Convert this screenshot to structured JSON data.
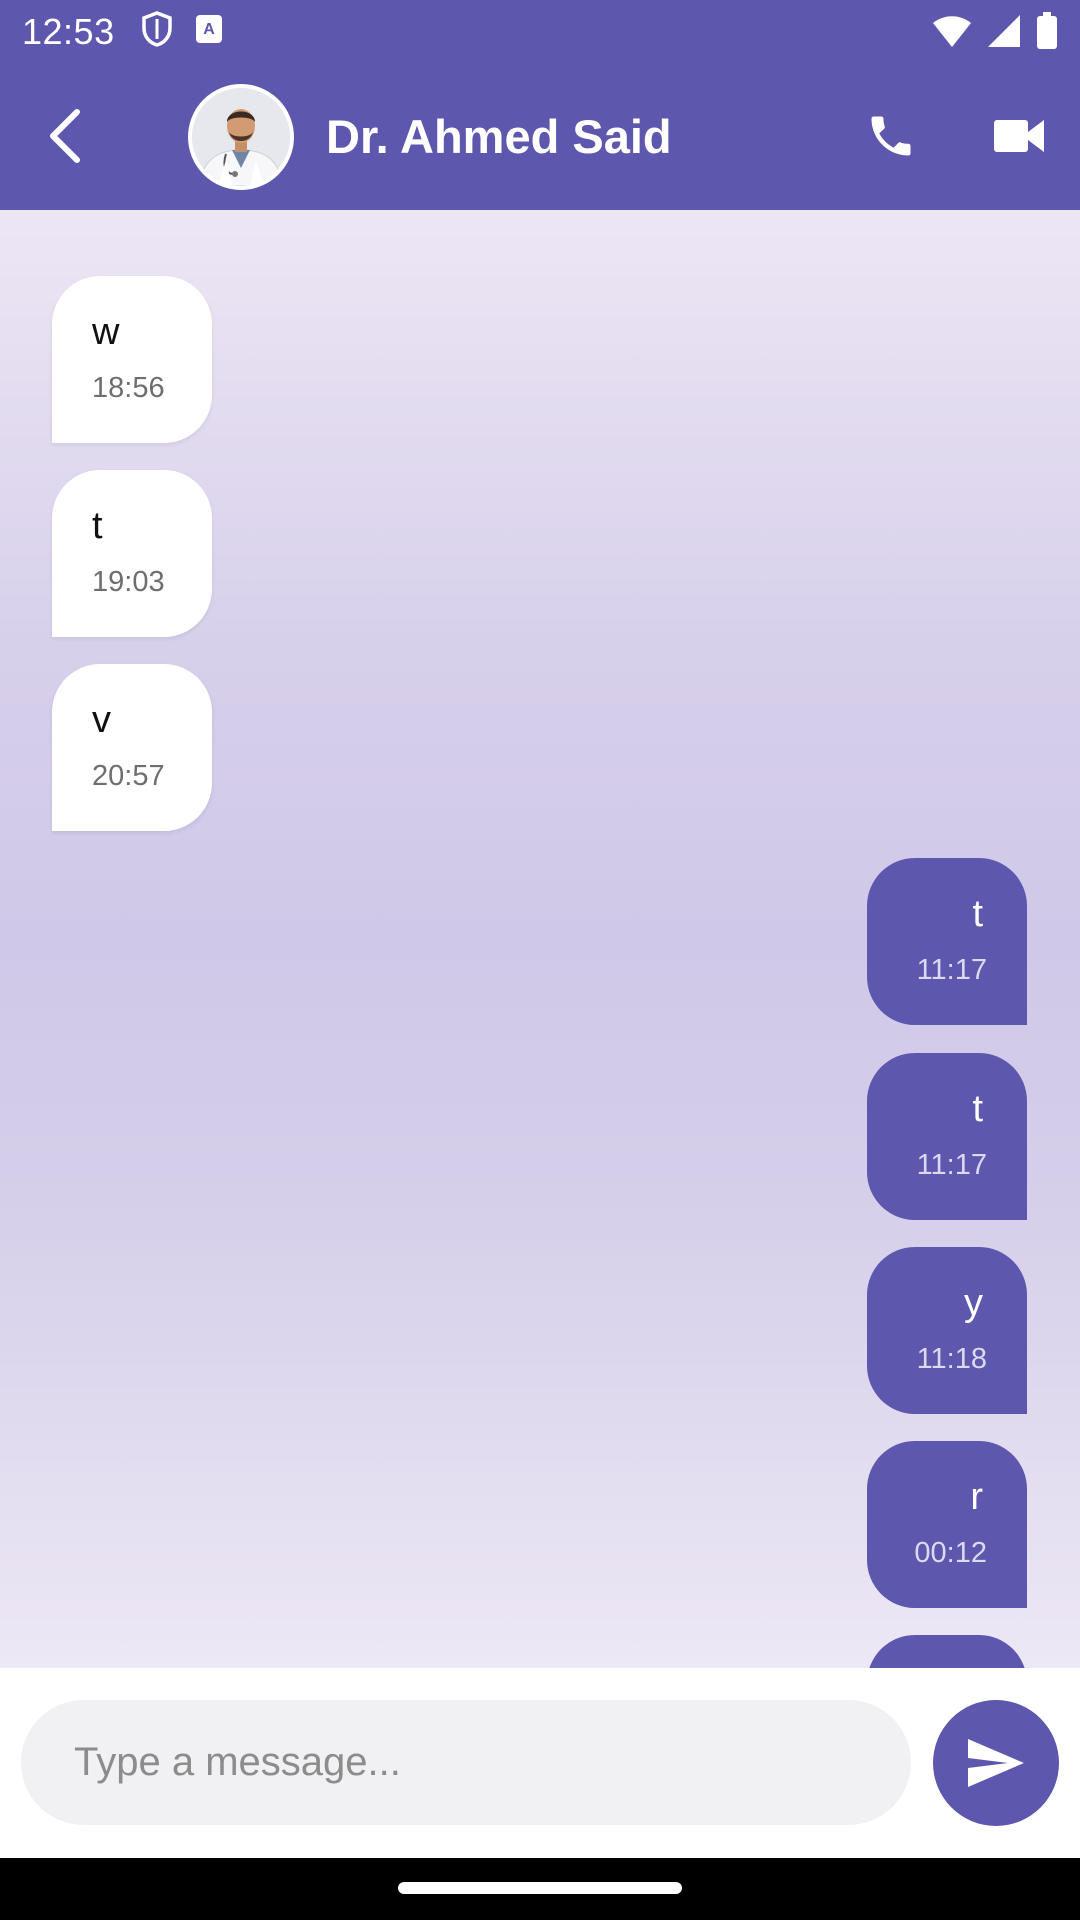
{
  "status_bar": {
    "time": "12:53",
    "icons": [
      "shield-icon",
      "text-a-icon",
      "wifi-icon",
      "signal-icon",
      "battery-icon"
    ]
  },
  "header": {
    "back_icon": "chevron-left-icon",
    "contact_name": "Dr. Ahmed Said",
    "avatar": "doctor-avatar",
    "call_icon": "phone-icon",
    "video_icon": "video-camera-icon",
    "background_color": "#5D57AE"
  },
  "messages": [
    {
      "direction": "incoming",
      "text": "w",
      "time": "18:56"
    },
    {
      "direction": "incoming",
      "text": "t",
      "time": "19:03"
    },
    {
      "direction": "incoming",
      "text": "v",
      "time": "20:57"
    },
    {
      "direction": "outgoing",
      "text": "t",
      "time": "11:17"
    },
    {
      "direction": "outgoing",
      "text": "t",
      "time": "11:17"
    },
    {
      "direction": "outgoing",
      "text": "y",
      "time": "11:18"
    },
    {
      "direction": "outgoing",
      "text": "r",
      "time": "00:12"
    }
  ],
  "input": {
    "placeholder": "Type a message...",
    "value": "",
    "send_icon": "send-icon"
  },
  "colors": {
    "accent": "#5D57AE",
    "incoming_bubble": "#FFFFFF",
    "outgoing_bubble": "#5D57AE"
  }
}
